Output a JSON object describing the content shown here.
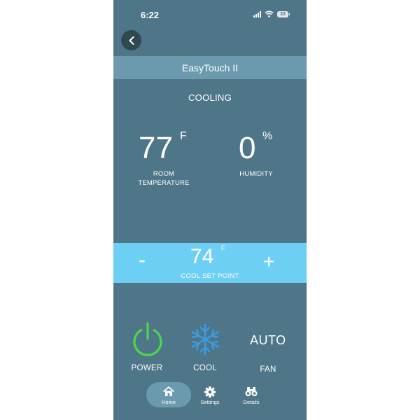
{
  "status_bar": {
    "time": "6:22",
    "battery": "33"
  },
  "header": {
    "title": "EasyTouch II"
  },
  "mode": "COOLING",
  "room_temperature": {
    "value": "77",
    "unit": "F",
    "label_line1": "ROOM",
    "label_line2": "TEMPERATURE"
  },
  "humidity": {
    "value": "0",
    "unit": "%",
    "label": "HUMIDITY"
  },
  "setpoint": {
    "minus": "-",
    "plus": "+",
    "value": "74",
    "unit": "F",
    "label": "COOL SET POINT"
  },
  "controls": {
    "power_label": "POWER",
    "mode_label": "COOL",
    "fan_value": "AUTO",
    "fan_label": "FAN"
  },
  "nav": {
    "items": [
      {
        "label": "Home",
        "icon": "home-icon"
      },
      {
        "label": "Settings",
        "icon": "gear-icon"
      },
      {
        "label": "Details",
        "icon": "binoculars-icon"
      }
    ]
  },
  "colors": {
    "background": "#4f7688",
    "title_bar": "#6b9aae",
    "setpoint_bar": "#6ecff5",
    "power_green": "#4cd64c",
    "cool_blue": "#3a9ae0"
  }
}
